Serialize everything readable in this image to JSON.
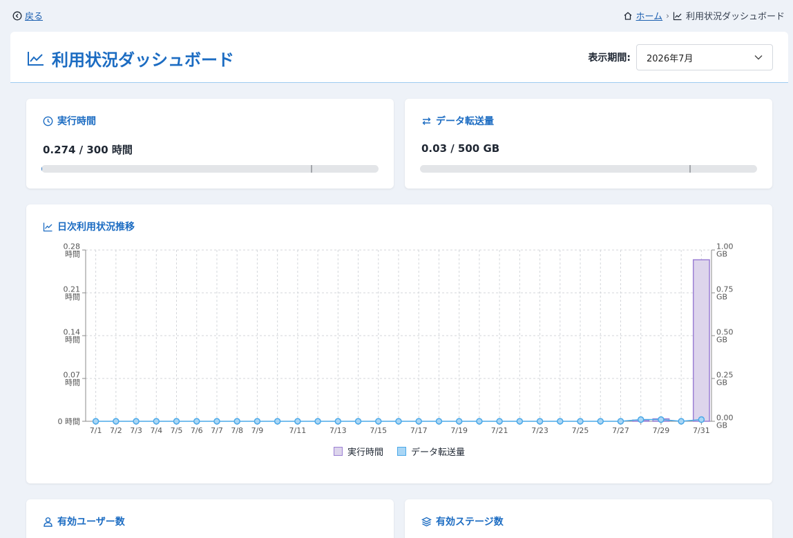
{
  "nav": {
    "back_label": "戻る",
    "breadcrumb_home": "ホーム",
    "breadcrumb_current": "利用状況ダッシュボード"
  },
  "header": {
    "title": "利用状況ダッシュボード",
    "period_label": "表示期間:",
    "period_value": "2026年7月"
  },
  "runtime": {
    "title": "実行時間",
    "value": "0.274 / 300 時間",
    "used": 0.274,
    "limit": 300,
    "marker_pct": 80
  },
  "transfer": {
    "title": "データ転送量",
    "value": "0.03 / 500 GB",
    "used": 0.03,
    "limit": 500,
    "marker_pct": 80
  },
  "chart_card": {
    "title": "日次利用状況推移"
  },
  "lower": {
    "users_title": "有効ユーザー数",
    "stages_title": "有効ステージ数"
  },
  "colors": {
    "accent": "#1c6cc2",
    "runtime_bar": "#9b7fd4",
    "runtime_fill": "#ddd5ec",
    "transfer_line": "#4aa8e8",
    "transfer_fill": "#a9d6f5"
  },
  "chart_data": {
    "type": "bar",
    "x": [
      "7/1",
      "7/2",
      "7/3",
      "7/4",
      "7/5",
      "7/6",
      "7/7",
      "7/8",
      "7/9",
      "7/10",
      "7/11",
      "7/12",
      "7/13",
      "7/14",
      "7/15",
      "7/16",
      "7/17",
      "7/18",
      "7/19",
      "7/20",
      "7/21",
      "7/22",
      "7/23",
      "7/24",
      "7/25",
      "7/26",
      "7/27",
      "7/28",
      "7/29",
      "7/30",
      "7/31"
    ],
    "x_tick_labels": [
      "7/1",
      "7/2",
      "7/3",
      "7/4",
      "7/5",
      "7/6",
      "7/7",
      "7/8",
      "7/9",
      "",
      "7/11",
      "",
      "7/13",
      "",
      "7/15",
      "",
      "7/17",
      "",
      "7/19",
      "",
      "7/21",
      "",
      "7/23",
      "",
      "7/25",
      "",
      "7/27",
      "",
      "7/29",
      "",
      "7/31"
    ],
    "y_left": {
      "ticks": [
        0,
        0.07,
        0.14,
        0.21,
        0.28
      ],
      "tick_labels": [
        "0 時間",
        "0.07\n時間",
        "0.14\n時間",
        "0.21\n時間",
        "0.28\n時間"
      ],
      "ylim": [
        0,
        0.28
      ]
    },
    "y_right": {
      "ticks": [
        0,
        0.25,
        0.5,
        0.75,
        1.0
      ],
      "tick_labels": [
        "0.00\nGB",
        "0.25\nGB",
        "0.50\nGB",
        "0.75\nGB",
        "1.00\nGB"
      ],
      "ylim": [
        0,
        1.0
      ]
    },
    "series": [
      {
        "name": "実行時間",
        "axis": "left",
        "kind": "bar",
        "values": [
          0,
          0,
          0,
          0,
          0,
          0,
          0,
          0,
          0,
          0,
          0,
          0,
          0,
          0,
          0,
          0,
          0,
          0,
          0,
          0,
          0,
          0,
          0,
          0,
          0,
          0,
          0,
          0.002,
          0.004,
          0,
          0.264
        ]
      },
      {
        "name": "データ転送量",
        "axis": "right",
        "kind": "line",
        "values": [
          0,
          0,
          0,
          0,
          0,
          0,
          0,
          0,
          0,
          0,
          0,
          0,
          0,
          0,
          0,
          0,
          0,
          0,
          0,
          0,
          0,
          0,
          0,
          0,
          0,
          0,
          0,
          0.01,
          0.01,
          0,
          0.01
        ]
      }
    ],
    "grid": true,
    "legend": "bottom-center"
  }
}
